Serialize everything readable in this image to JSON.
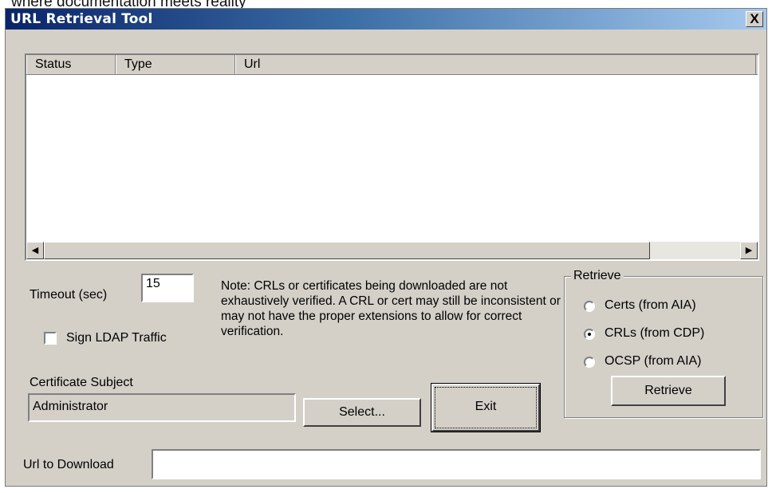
{
  "caption": "where documentation meets reality",
  "window": {
    "title": "URL Retrieval Tool",
    "close_glyph": "X"
  },
  "listview": {
    "columns": [
      "Status",
      "Type",
      "Url"
    ],
    "scroll_left_glyph": "◀",
    "scroll_right_glyph": "▶"
  },
  "timeout": {
    "label": "Timeout (sec)",
    "value": "15"
  },
  "sign_ldap": {
    "label": "Sign LDAP Traffic",
    "checked": false
  },
  "note": "Note: CRLs or certificates being downloaded are not exhaustively verified.  A CRL or cert may still be inconsistent or may not have the proper extensions to allow for correct verification.",
  "certificate_subject": {
    "label": "Certificate Subject",
    "value": "Administrator"
  },
  "buttons": {
    "select": "Select...",
    "exit": "Exit",
    "retrieve": "Retrieve"
  },
  "retrieve_group": {
    "title": "Retrieve",
    "options": [
      "Certs (from AIA)",
      "CRLs (from CDP)",
      "OCSP (from AIA)"
    ],
    "selected_index": 1
  },
  "url_download": {
    "label": "Url to Download",
    "value": ""
  }
}
